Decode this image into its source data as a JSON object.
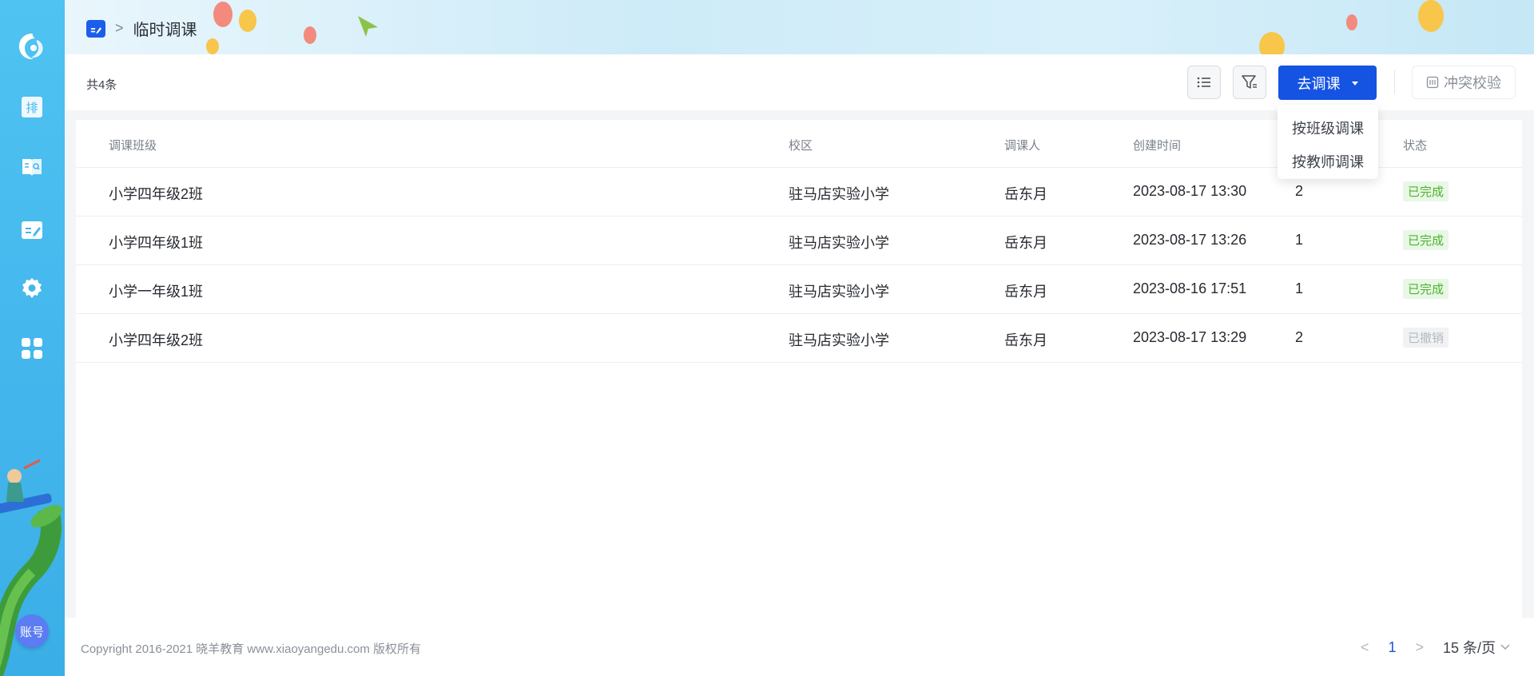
{
  "sidebar": {
    "logo": "logo-swirl",
    "items": [
      {
        "name": "schedule-icon",
        "glyph": "排"
      },
      {
        "name": "course-search-icon"
      },
      {
        "name": "adjust-course-icon"
      },
      {
        "name": "settings-gear-icon"
      },
      {
        "name": "apps-grid-icon"
      }
    ],
    "account_label": "账号"
  },
  "header": {
    "crumb_separator": ">",
    "title": "临时调课"
  },
  "toolbar": {
    "total": "共4条",
    "primary_label": "去调课",
    "conflict_label": "冲突校验"
  },
  "dropdown": {
    "items": [
      "按班级调课",
      "按教师调课"
    ]
  },
  "table": {
    "columns": [
      "调课班级",
      "校区",
      "调课人",
      "创建时间",
      "",
      "状态"
    ],
    "rows": [
      {
        "class": "小学四年级2班",
        "campus": "驻马店实验小学",
        "person": "岳东月",
        "created": "2023-08-17 13:30",
        "count": "2",
        "status": "已完成",
        "status_type": "done"
      },
      {
        "class": "小学四年级1班",
        "campus": "驻马店实验小学",
        "person": "岳东月",
        "created": "2023-08-17 13:26",
        "count": "1",
        "status": "已完成",
        "status_type": "done"
      },
      {
        "class": "小学一年级1班",
        "campus": "驻马店实验小学",
        "person": "岳东月",
        "created": "2023-08-16 17:51",
        "count": "1",
        "status": "已完成",
        "status_type": "done"
      },
      {
        "class": "小学四年级2班",
        "campus": "驻马店实验小学",
        "person": "岳东月",
        "created": "2023-08-17 13:29",
        "count": "2",
        "status": "已撤销",
        "status_type": "cancel"
      }
    ]
  },
  "footer": {
    "copyright": "Copyright 2016-2021 晓羊教育 www.xiaoyangedu.com 版权所有",
    "page_prev": "<",
    "page_current": "1",
    "page_next": ">",
    "page_size": "15 条/页"
  },
  "colors": {
    "primary": "#1554e3",
    "sidebar": "#42b6ec",
    "done": "#4cb32c",
    "cancel": "#b3b8bf"
  }
}
